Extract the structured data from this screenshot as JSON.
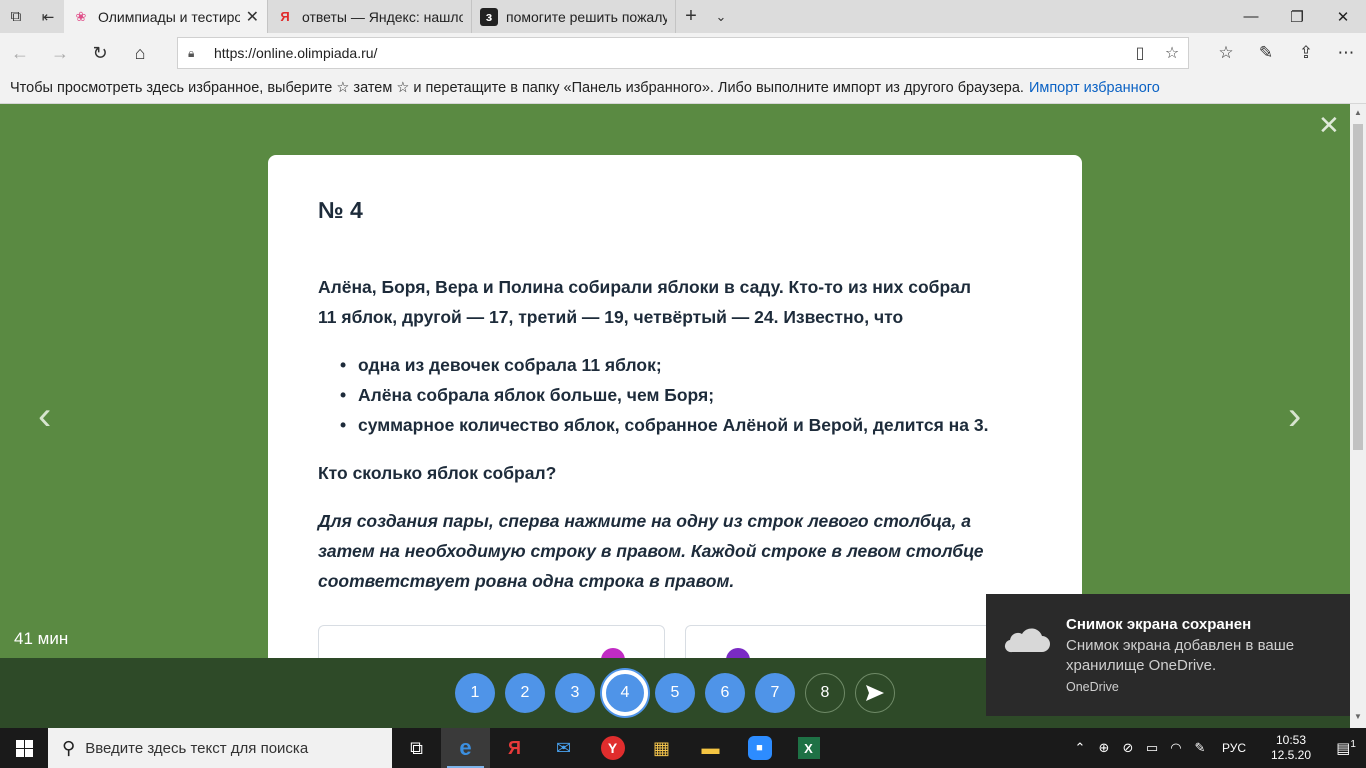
{
  "browser": {
    "tabs": [
      {
        "title": "Олимпиады и тестирое",
        "favicon": "olimpiada-icon",
        "active": true
      },
      {
        "title": "ответы — Яндекс: нашлось",
        "favicon": "yandex-icon",
        "active": false
      },
      {
        "title": "помогите решить пожалуй",
        "favicon": "znanija-icon",
        "active": false
      }
    ],
    "url": "https://online.olimpiada.ru/",
    "favorites_bar": {
      "text": "Чтобы просмотреть здесь избранное, выберите ☆ затем ☆ и перетащите в папку «Панель избранного». Либо выполните импорт из другого браузера.",
      "link": "Импорт избранного"
    }
  },
  "task": {
    "number": "№ 4",
    "intro_line1": "Алёна, Боря, Вера и Полина собирали яблоки в саду. Кто-то из них собрал",
    "intro_line2": "11 яблок, другой — 17, третий — 19, четвёртый — 24. Известно, что",
    "conditions": [
      "одна из девочек собрала 11 яблок;",
      "Алёна собрала яблок больше, чем Боря;",
      "суммарное количество яблок, собранное Алёной и Верой, делится на 3."
    ],
    "question": "Кто сколько яблок собрал?",
    "instruction": "Для создания пары, сперва нажмите на одну из строк левого столбца, а затем на необходимую строку в правом. Каждой строке в левом столбце соответствует ровна одна строка в правом."
  },
  "timer": "41 мин",
  "question_nav": [
    "1",
    "2",
    "3",
    "4",
    "5",
    "6",
    "7",
    "8"
  ],
  "current_question": "4",
  "toast": {
    "title": "Снимок экрана сохранен",
    "body": "Снимок экрана добавлен в ваше хранилище OneDrive.",
    "source": "OneDrive"
  },
  "taskbar": {
    "search_placeholder": "Введите здесь текст для поиска",
    "lang": "РУС",
    "time": "10:53",
    "date": "12.5.20",
    "notif_count": "1"
  },
  "colors": {
    "page_bg": "#5a8a42",
    "bottom_bar": "#2e4a28",
    "question_btn": "#4f94e8",
    "left_dot": "#c12bc4",
    "right_dot": "#7a2bc4"
  }
}
